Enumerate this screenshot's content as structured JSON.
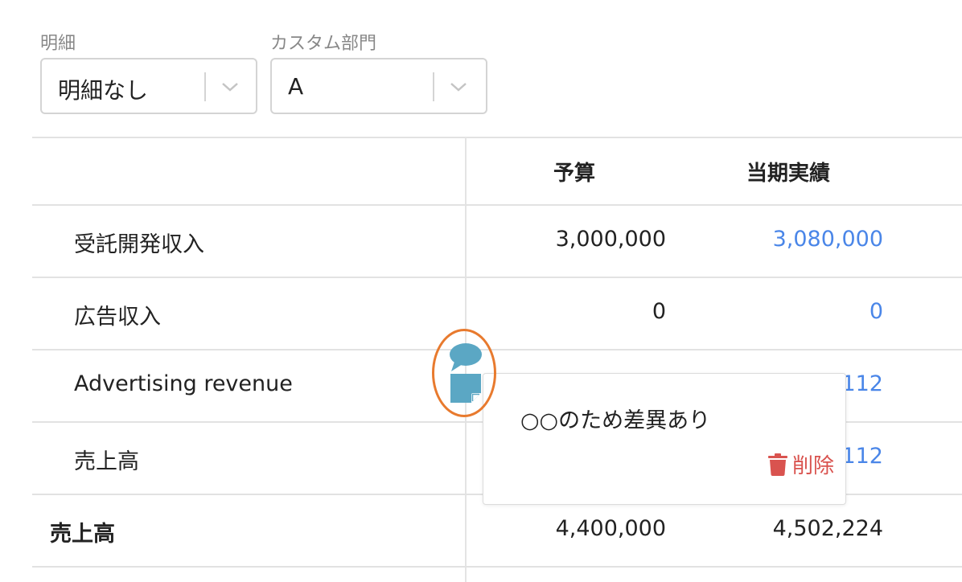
{
  "filters": {
    "detail": {
      "label": "明細",
      "value": "明細なし"
    },
    "custom": {
      "label": "カスタム部門",
      "value": "A"
    }
  },
  "table": {
    "headers": {
      "budget": "予算",
      "actual": "当期実績"
    },
    "rows": [
      {
        "label": "受託開発収入",
        "budget": "3,000,000",
        "actual": "3,080,000"
      },
      {
        "label": "広告収入",
        "budget": "0",
        "actual": "0"
      },
      {
        "label": "Advertising revenue",
        "budget": "",
        "actual": "112"
      },
      {
        "label": "売上高",
        "budget": "",
        "actual": "112"
      },
      {
        "label": "売上高",
        "budget": "4,400,000",
        "actual": "4,502,224"
      }
    ]
  },
  "comment_popover": {
    "text": "○○のため差異あり",
    "delete_label": "削除"
  },
  "colors": {
    "link_blue": "#4a86e8",
    "delete_red": "#d9534f",
    "icon_teal": "#5ba7c4",
    "highlight_orange": "#e87a2e"
  }
}
